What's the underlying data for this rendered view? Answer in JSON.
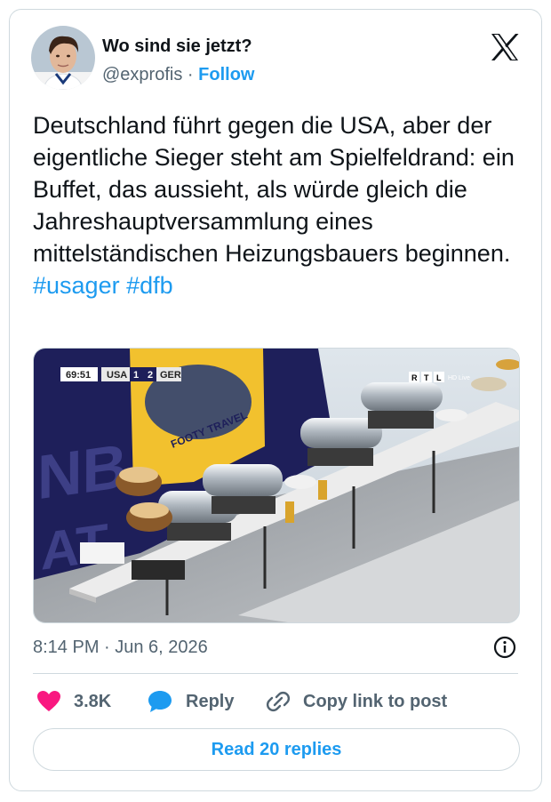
{
  "author": {
    "name": "Wo sind sie jetzt?",
    "handle": "@exprofis",
    "separator": "·",
    "follow_label": "Follow"
  },
  "tweet": {
    "text": "Deutschland führt gegen die USA, aber der eigentliche Sieger steht am Spielfeldrand: ein Buffet, das aussieht, als würde gleich die Jahreshauptversammlung eines mittelständischen Heizungsbauers beginnen.",
    "hashtags": [
      "#usager",
      "#dfb"
    ]
  },
  "media": {
    "scoreboard": {
      "clock": "69:51",
      "team_home": "USA",
      "score_home": "1",
      "score_away": "2",
      "team_away": "GER"
    },
    "broadcaster": "RTL",
    "broadcaster_quality": "HD Live",
    "banner_text": "FOOTY TRAVEL"
  },
  "meta": {
    "timestamp": "8:14 PM · Jun 6, 2026"
  },
  "actions": {
    "likes": "3.8K",
    "reply_label": "Reply",
    "copy_label": "Copy link to post"
  },
  "read_replies_label": "Read 20 replies",
  "colors": {
    "accent": "#1d9bf0",
    "like": "#f91880",
    "muted": "#536471",
    "border": "#cfd9de"
  }
}
